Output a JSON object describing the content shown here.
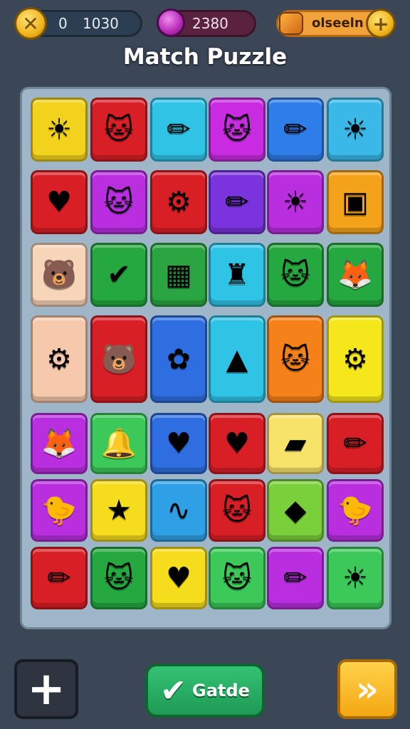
{
  "hud": {
    "coins_value_a": "0",
    "coins_value_b": "1030",
    "gems_value": "2380",
    "bonus_label": "olseeln",
    "coin_icon": "coin-x-icon",
    "gem_icon": "gem-icon",
    "plus_icon": "plus-icon"
  },
  "title": "Match Puzzle",
  "board": {
    "rows": [
      [
        {
          "icon": "sun",
          "glyph": "☀",
          "color": "#f2d21c"
        },
        {
          "icon": "cat",
          "glyph": "🐱",
          "color": "#d81f26"
        },
        {
          "icon": "crossed-pencils",
          "glyph": "✏",
          "color": "#2fc4e6"
        },
        {
          "icon": "cat",
          "glyph": "🐱",
          "color": "#c82be0"
        },
        {
          "icon": "pencil",
          "glyph": "✏",
          "color": "#2f7de8"
        },
        {
          "icon": "sun-face",
          "glyph": "☀",
          "color": "#3ab9e8"
        }
      ],
      [
        {
          "icon": "heart",
          "glyph": "♥",
          "color": "#d81f26"
        },
        {
          "icon": "cat",
          "glyph": "🐱",
          "color": "#b92fe0"
        },
        {
          "icon": "gadget",
          "glyph": "⚙",
          "color": "#d81f26"
        },
        {
          "icon": "pencil",
          "glyph": "✏",
          "color": "#7b33de"
        },
        {
          "icon": "sun",
          "glyph": "☀",
          "color": "#b92fe0"
        },
        {
          "icon": "blocks",
          "glyph": "▣",
          "color": "#f4a21a"
        }
      ],
      [
        {
          "icon": "bear",
          "glyph": "🐻",
          "color": "#f7d5b8"
        },
        {
          "icon": "check",
          "glyph": "✔",
          "color": "#25a83f"
        },
        {
          "icon": "frame",
          "glyph": "▦",
          "color": "#2ba542"
        },
        {
          "icon": "lantern",
          "glyph": "♜",
          "color": "#2fc4e6"
        },
        {
          "icon": "ghost-cat",
          "glyph": "🐱",
          "color": "#25a83f"
        },
        {
          "icon": "fox",
          "glyph": "🦊",
          "color": "#25a83f"
        }
      ],
      [
        {
          "icon": "gear-face",
          "glyph": "⚙",
          "color": "#f6c9ad"
        },
        {
          "icon": "bear",
          "glyph": "🐻",
          "color": "#d81f26"
        },
        {
          "icon": "flower",
          "glyph": "✿",
          "color": "#2f6ee0"
        },
        {
          "icon": "hat",
          "glyph": "▲",
          "color": "#2fc4e6"
        },
        {
          "icon": "cat",
          "glyph": "🐱",
          "color": "#f4811a"
        },
        {
          "icon": "gadget",
          "glyph": "⚙",
          "color": "#f5e71c"
        }
      ],
      [
        {
          "icon": "fox",
          "glyph": "🦊",
          "color": "#b92fe0"
        },
        {
          "icon": "bell",
          "glyph": "🔔",
          "color": "#3cc95a"
        },
        {
          "icon": "picture-heart",
          "glyph": "♥",
          "color": "#2f6ee0"
        },
        {
          "icon": "heart",
          "glyph": "♥",
          "color": "#d81f26"
        },
        {
          "icon": "eraser",
          "glyph": "▰",
          "color": "#f7e26a"
        },
        {
          "icon": "pencil",
          "glyph": "✏",
          "color": "#d81f26"
        }
      ],
      [
        {
          "icon": "chick",
          "glyph": "🐤",
          "color": "#b92fe0"
        },
        {
          "icon": "star",
          "glyph": "★",
          "color": "#f5dc1c"
        },
        {
          "icon": "worm",
          "glyph": "∿",
          "color": "#2fa0e6"
        },
        {
          "icon": "cat",
          "glyph": "🐱",
          "color": "#d81f26"
        },
        {
          "icon": "gem",
          "glyph": "◆",
          "color": "#7ad03a"
        },
        {
          "icon": "chick",
          "glyph": "🐤",
          "color": "#b92fe0"
        }
      ],
      [
        {
          "icon": "pencil",
          "glyph": "✏",
          "color": "#d81f26"
        },
        {
          "icon": "cat",
          "glyph": "🐱",
          "color": "#25a83f"
        },
        {
          "icon": "heart",
          "glyph": "♥",
          "color": "#f5dc1c"
        },
        {
          "icon": "cat",
          "glyph": "🐱",
          "color": "#3cc95a"
        },
        {
          "icon": "pencil",
          "glyph": "✏",
          "color": "#b92fe0"
        },
        {
          "icon": "sun",
          "glyph": "☀",
          "color": "#3cc95a"
        }
      ]
    ]
  },
  "buttons": {
    "add_glyph": "+",
    "check_glyph": "✔",
    "check_label": "Gatde",
    "next_glyph": "»"
  }
}
